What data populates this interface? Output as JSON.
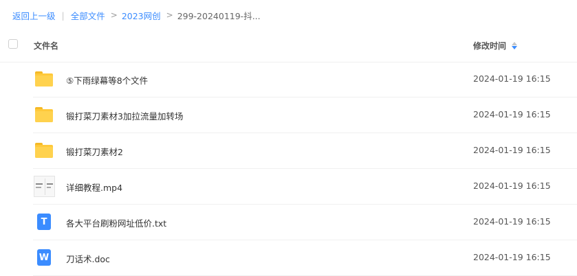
{
  "breadcrumb": {
    "back": "返回上一级",
    "separator_bar": "|",
    "separator": ">",
    "items": [
      "全部文件",
      "2023网创",
      "299-20240119-抖..."
    ]
  },
  "table": {
    "col_name": "文件名",
    "col_time": "修改时间"
  },
  "files": [
    {
      "name": "⑤下雨绿幕等8个文件",
      "time": "2024-01-19 16:15",
      "icon": "folder-icon"
    },
    {
      "name": "锻打菜刀素材3加拉流量加转场",
      "time": "2024-01-19 16:15",
      "icon": "folder-icon"
    },
    {
      "name": "锻打菜刀素材2",
      "time": "2024-01-19 16:15",
      "icon": "folder-icon"
    },
    {
      "name": "详细教程.mp4",
      "time": "2024-01-19 16:15",
      "icon": "video-thumbnail-icon"
    },
    {
      "name": "各大平台刷粉网址低价.txt",
      "time": "2024-01-19 16:15",
      "icon": "txt-file-icon",
      "glyph": "T"
    },
    {
      "name": "刀话术.doc",
      "time": "2024-01-19 16:15",
      "icon": "word-file-icon",
      "glyph": "W"
    }
  ],
  "colors": {
    "accent": "#3b8cff",
    "folder": "#ffc93a"
  }
}
